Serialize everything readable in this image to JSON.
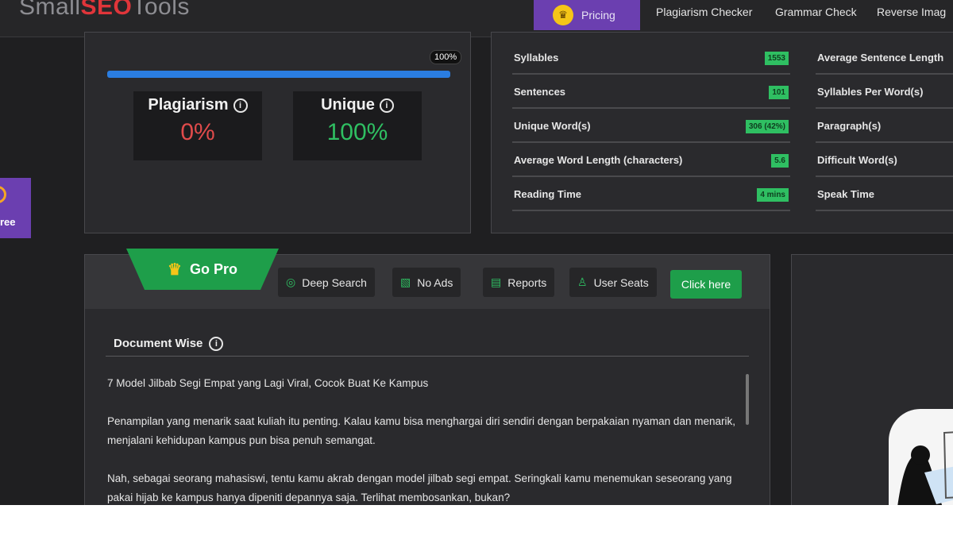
{
  "header": {
    "logo_left": "Small",
    "logo_accent": "SEO",
    "logo_right": "Tools",
    "pricing_label": "Pricing",
    "nav": [
      "Plagiarism Checker",
      "Grammar Check",
      "Reverse Imag"
    ]
  },
  "promo": {
    "label": "ree"
  },
  "result": {
    "progress_label": "100%",
    "progress_value": 1.0,
    "plagiarism_title": "Plagiarism",
    "plagiarism_value": "0%",
    "unique_title": "Unique",
    "unique_value": "100%"
  },
  "stats": {
    "left": [
      {
        "label": "Syllables",
        "value": "1553"
      },
      {
        "label": "Sentences",
        "value": "101"
      },
      {
        "label": "Unique Word(s)",
        "value": "306 (42%)"
      },
      {
        "label": "Average Word Length (characters)",
        "value": "5.6"
      },
      {
        "label": "Reading Time",
        "value": "4 mins"
      }
    ],
    "right": [
      {
        "label": "Average Sentence Length"
      },
      {
        "label": "Syllables Per Word(s)"
      },
      {
        "label": "Paragraph(s)"
      },
      {
        "label": "Difficult Word(s)"
      },
      {
        "label": "Speak Time"
      }
    ]
  },
  "pro": {
    "gopro_label": "Go Pro",
    "features": [
      "Deep Search",
      "No Ads",
      "Reports",
      "User Seats"
    ],
    "cta": "Click here"
  },
  "document": {
    "heading": "Document Wise",
    "paragraphs": [
      "7 Model Jilbab Segi Empat yang Lagi Viral, Cocok Buat Ke Kampus",
      "Penampilan yang menarik saat kuliah itu penting. Kalau kamu bisa menghargai diri sendiri dengan berpakaian nyaman dan menarik, menjalani kehidupan kampus pun bisa penuh semangat.",
      "Nah, sebagai seorang mahasiswi, tentu kamu akrab dengan model jilbab segi empat. Seringkali kamu menemukan seseorang yang pakai hijab ke kampus hanya dipeniti depannya saja. Terlihat membosankan, bukan?"
    ]
  },
  "colors": {
    "accent_purple": "#6b3fb0",
    "success_green": "#2fbf62",
    "danger_red": "#e04b4b",
    "progress_blue": "#2a7de1"
  }
}
